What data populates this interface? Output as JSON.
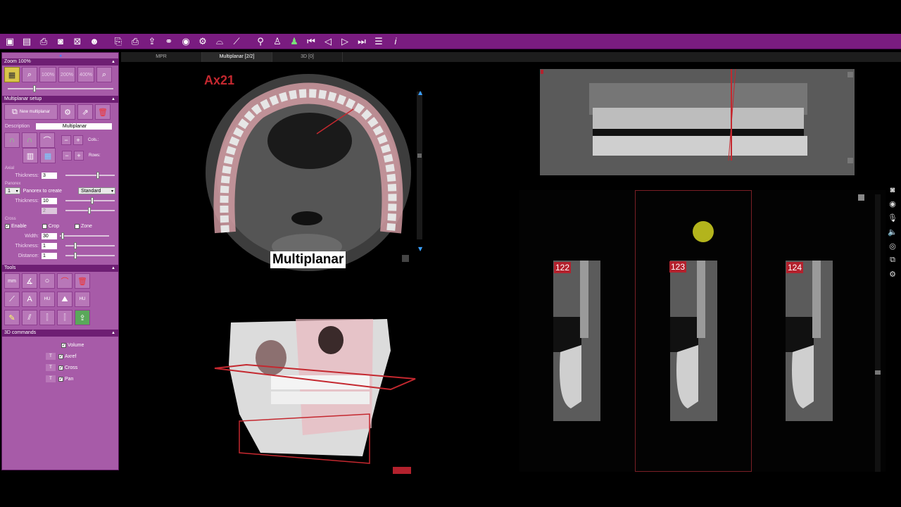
{
  "toolbar": {
    "icons": [
      "save-icon",
      "save-all-icon",
      "print-icon",
      "camera-icon",
      "close-window-icon",
      "user-settings-icon",
      "print-preview-icon",
      "printer-icon",
      "export-icon",
      "network-icon",
      "eye-icon",
      "implant-icon",
      "panorex-icon",
      "measure-icon",
      "tooth-icon",
      "crown-icon",
      "first-icon",
      "prev-icon",
      "play-icon",
      "last-icon",
      "list-icon",
      "info-icon"
    ]
  },
  "sidebar": {
    "zoom": {
      "header": "Zoom 100%",
      "btn_100": "100%",
      "btn_200": "200%",
      "btn_400": "400%"
    },
    "multiplanar_setup": {
      "header": "Multiplanar setup",
      "new_label": "New multiplanar",
      "description_label": "Description",
      "description_value": "Multiplanar",
      "cols_label": "Cols.:",
      "rows_label": "Rows:",
      "axial_label": "Axial",
      "thickness_label": "Thickness:",
      "axial_thickness": "3",
      "panorex_label": "Panorex",
      "panorex_count": "1",
      "panorex_to_create": "Panorex to create",
      "panorex_mode": "Standard",
      "panorex_thickness": "10",
      "panorex_other_value": "2",
      "cross_label": "Cross",
      "enable_label": "Enable",
      "crop_label": "Crop",
      "zone_label": "Zone",
      "width_label": "Width:",
      "width_value": "30",
      "cross_thickness": "1",
      "distance_label": "Distance:",
      "distance_value": "1"
    },
    "tools": {
      "header": "Tools",
      "mm": "mm",
      "hu": "HU"
    },
    "commands_3d": {
      "header": "3D commands",
      "items": [
        {
          "label": "Volume",
          "checked": true
        },
        {
          "label": "Axref",
          "checked": true
        },
        {
          "label": "Cross",
          "checked": true
        },
        {
          "label": "Pan",
          "checked": true
        }
      ],
      "t_label": "T"
    }
  },
  "tabs": [
    {
      "label": "MPR",
      "active": false
    },
    {
      "label": "Multiplanar [2/2]",
      "active": true
    },
    {
      "label": "3D [0]",
      "active": false
    }
  ],
  "viewports": {
    "axial": {
      "label": "Ax21",
      "overlay_title": "Multiplanar"
    },
    "sections": [
      {
        "label": "122"
      },
      {
        "label": "123"
      },
      {
        "label": "124"
      }
    ]
  },
  "colors": {
    "toolbar_bg": "#7a1c80",
    "sidebar_bg": "#a75ba8",
    "accent_red": "#c4282f",
    "cursor_yellow": "#c6c81f"
  }
}
